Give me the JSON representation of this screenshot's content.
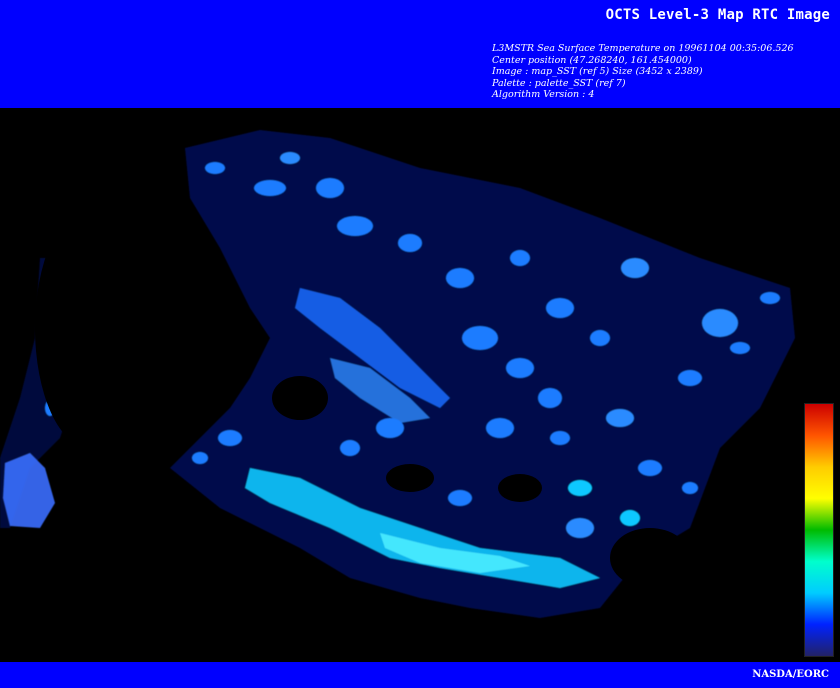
{
  "header": {
    "title": "OCTS Level-3 Map RTC Image",
    "info_lines": [
      "L3MSTR Sea Surface Temperature on 19961104 00:35:06.526",
      "Center position (47.268240, 161.454000)",
      "Image : map_SST (ref 5) Size (3452 x 2389)",
      "Palette : palette_SST (ref 7)",
      "Algorithm Version : 4"
    ]
  },
  "map": {
    "background_color": "#000000",
    "data_color_range": [
      "#0a2cff",
      "#00e8ff"
    ]
  },
  "colorbar": {
    "colors": [
      "#cc0000",
      "#ff5500",
      "#ffcc00",
      "#ffff00",
      "#00bb00",
      "#00ffcc",
      "#00ccff",
      "#0022ff",
      "#222266"
    ]
  },
  "footer": {
    "credit": "NASDA/EORC"
  },
  "colors": {
    "header_bg": "#0000ff",
    "text": "#ffffff"
  }
}
